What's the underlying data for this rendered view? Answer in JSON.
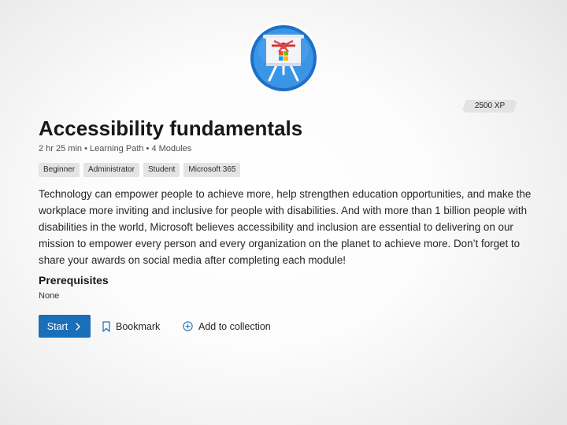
{
  "module": {
    "xp": "2500 XP",
    "title": "Accessibility fundamentals",
    "meta": "2 hr 25 min • Learning Path • 4 Modules",
    "tags": [
      "Beginner",
      "Administrator",
      "Student",
      "Microsoft 365"
    ],
    "description": "Technology can empower people to achieve more, help strengthen education opportunities, and make the workplace more inviting and inclusive for people with disabilities. And with more than 1 billion people with disabilities in the world, Microsoft believes accessibility and inclusion are essential to delivering on our mission to empower every person and every organization on the planet to achieve more. Don’t forget to share your awards on social media after completing each module!"
  },
  "prerequisites": {
    "heading": "Prerequisites",
    "value": "None"
  },
  "actions": {
    "start_label": "Start",
    "bookmark_label": "Bookmark",
    "add_collection_label": "Add to collection"
  },
  "icons": {
    "badge": "presentation-easel-badge-icon",
    "start": "chevron-right-icon",
    "bookmark": "bookmark-icon",
    "add": "add-circle-icon"
  },
  "colors": {
    "accent": "#1a6fb9",
    "badge_ring": "#1d6fc7",
    "badge_fill": "#2f8fe3"
  }
}
